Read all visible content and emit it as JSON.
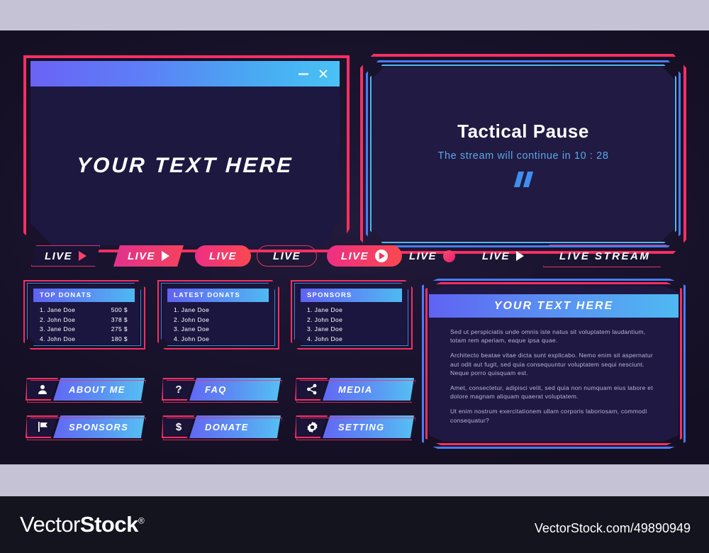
{
  "window_panel": {
    "text": "YOUR TEXT HERE",
    "minimize_icon": "minimize-icon",
    "close_icon": "close-icon"
  },
  "pause_panel": {
    "title": "Tactical Pause",
    "subtitle": "The stream will continue in 10 : 28",
    "marks_icon": "quote-marks-icon"
  },
  "live_badges": [
    {
      "label": "LIVE",
      "icon": "play-triangle-icon",
      "style": "outline-clipped"
    },
    {
      "label": "LIVE",
      "icon": "play-triangle-icon",
      "style": "solid-parallelogram"
    },
    {
      "label": "LIVE",
      "icon": "none",
      "style": "solid-pill"
    },
    {
      "label": "LIVE",
      "icon": "none",
      "style": "outline-pill"
    },
    {
      "label": "LIVE",
      "icon": "play-circle-icon",
      "style": "solid-pill"
    },
    {
      "label": "LIVE",
      "icon": "record-dot-icon",
      "style": "plain"
    },
    {
      "label": "LIVE",
      "icon": "play-triangle-icon",
      "style": "plain"
    },
    {
      "label": "LIVE STREAM",
      "icon": "none",
      "style": "outline-parallelogram"
    }
  ],
  "list_panels": [
    {
      "title": "TOP DONATS",
      "rows": [
        {
          "name": "1.  Jane Doe",
          "amount": "500 $"
        },
        {
          "name": "2. John Doe",
          "amount": "378 $"
        },
        {
          "name": "3. Jane Doe",
          "amount": "275 $"
        },
        {
          "name": "4. John Doe",
          "amount": "180 $"
        }
      ]
    },
    {
      "title": "LATEST DONATS",
      "rows": [
        {
          "name": "1.  Jane Doe",
          "amount": ""
        },
        {
          "name": "2. John Doe",
          "amount": ""
        },
        {
          "name": "3. Jane Doe",
          "amount": ""
        },
        {
          "name": "4. John Doe",
          "amount": ""
        }
      ]
    },
    {
      "title": "SPONSORS",
      "rows": [
        {
          "name": "1.  Jane Doe",
          "amount": ""
        },
        {
          "name": "2. John Doe",
          "amount": ""
        },
        {
          "name": "3. Jane Doe",
          "amount": ""
        },
        {
          "name": "4. John Doe",
          "amount": ""
        }
      ]
    }
  ],
  "text_panel": {
    "title": "YOUR TEXT HERE",
    "paragraphs": [
      "Sed ut perspiciatis unde omnis iste natus sit voluptatem laudantium, totam rem aperiam, eaque ipsa quae.",
      "Architecto beatae vitae dicta sunt explicabo. Nemo enim sit aspernatur aut odit aut fugit, sed quia consequuntur voluptatem sequi nesciunt. Neque porro quisquam est.",
      "Amet, consectetur, adipisci velit, sed quia non numquam eius labore et dolore magnam aliquam quaerat voluptatem.",
      "Ut enim  nostrum exercitationem ullam corporis   laboriosam, commodi consequatur?"
    ]
  },
  "menu_buttons": [
    {
      "label": "ABOUT ME",
      "icon": "person-icon",
      "glyph": "\u0000"
    },
    {
      "label": "FAQ",
      "icon": "question-icon",
      "glyph": "?"
    },
    {
      "label": "MEDIA",
      "icon": "share-icon",
      "glyph": "\u0000"
    },
    {
      "label": "SPONSORS",
      "icon": "flag-icon",
      "glyph": "\u0000"
    },
    {
      "label": "DONATE",
      "icon": "dollar-icon",
      "glyph": "$"
    },
    {
      "label": "SETTING",
      "icon": "gear-icon",
      "glyph": "\u0000"
    }
  ],
  "watermark": {
    "brand_light": "Vector",
    "brand_bold": "Stock",
    "registered": "®",
    "url": "VectorStock.com/49890949"
  },
  "colors": {
    "accent_pink": "#f72f62",
    "accent_blue": "#4a7cf7",
    "accent_cyan": "#4fb9f2",
    "panel_bg": "#1b1640",
    "canvas_bg": "#140f22",
    "letterbox": "#c5c2d6"
  }
}
